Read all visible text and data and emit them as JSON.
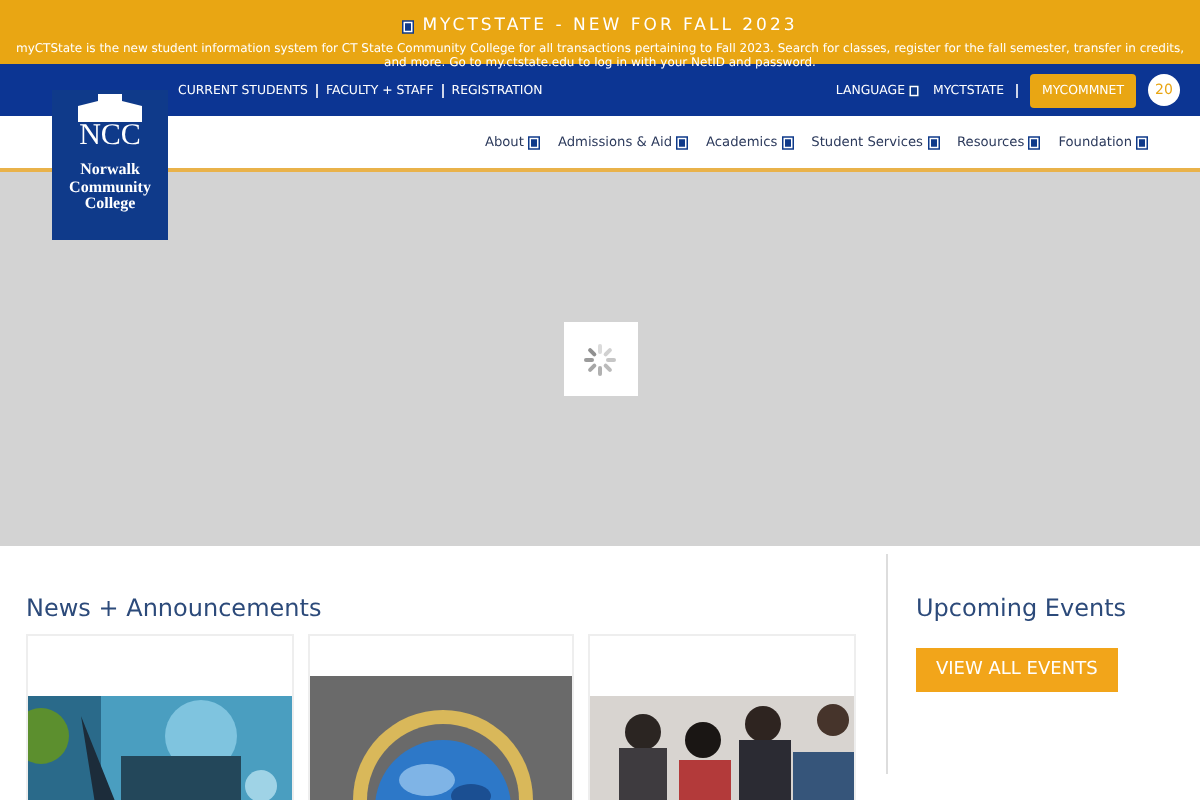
{
  "alert": {
    "title": "MYCTSTATE - NEW FOR FALL 2023",
    "text": "myCTState is the new student information system for CT State Community College for all transactions pertaining to Fall 2023. Search for classes, register for the fall semester, transfer in credits, and more. Go to my.ctstate.edu to log in with your NetID and password."
  },
  "top_links": [
    "CURRENT STUDENTS",
    "FACULTY + STAFF",
    "REGISTRATION"
  ],
  "utility": {
    "language": "LANGUAGE",
    "myctstate": "MYCTSTATE",
    "button": "MYCOMMNET",
    "badge": "20"
  },
  "logo": {
    "initials": "NCC",
    "name": "Norwalk Community College"
  },
  "nav": [
    "About",
    "Admissions & Aid",
    "Academics",
    "Student Services",
    "Resources",
    "Foundation"
  ],
  "news": {
    "title": "News + Announcements"
  },
  "events": {
    "title": "Upcoming Events",
    "button": "VIEW ALL EVENTS"
  }
}
